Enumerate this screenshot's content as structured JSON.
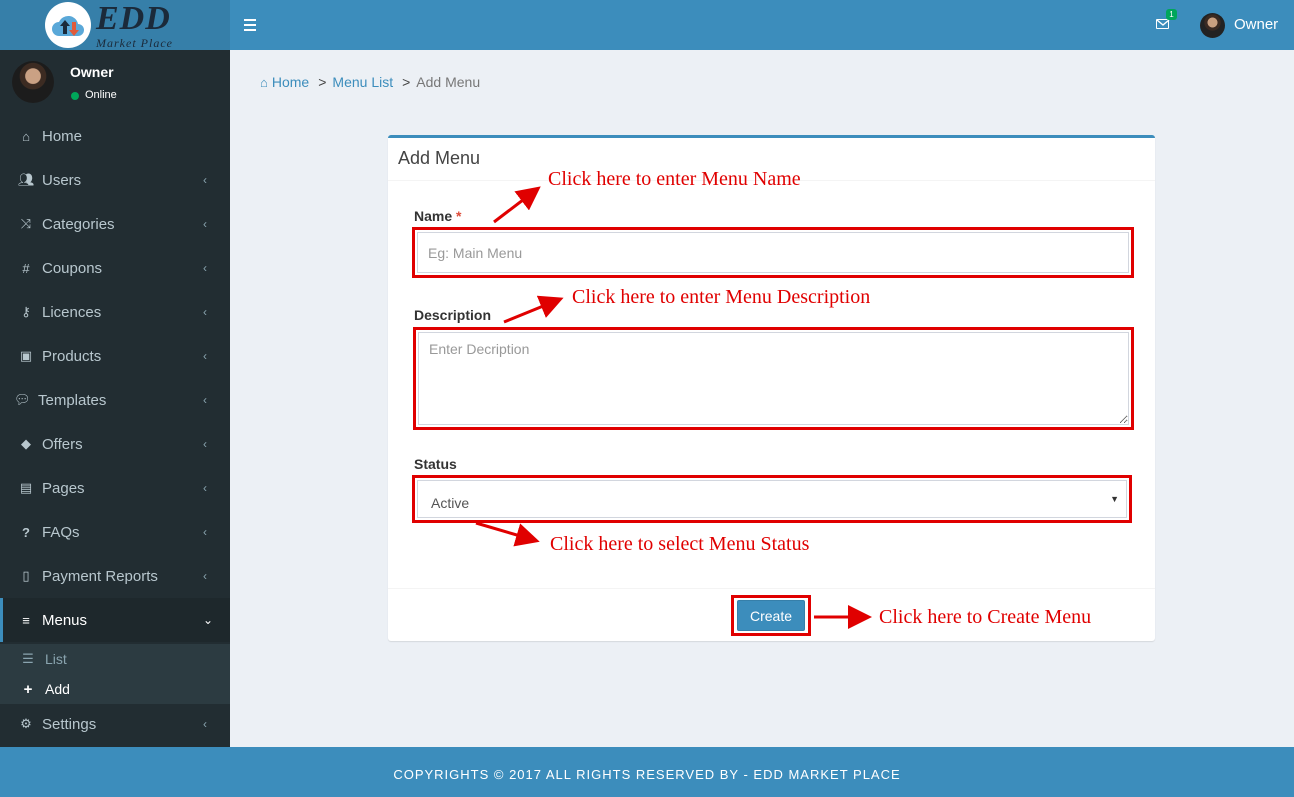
{
  "brand": {
    "title": "EDD",
    "subtitle": "Market Place"
  },
  "topbar": {
    "mail_badge": "1",
    "user_name": "Owner"
  },
  "sidebar": {
    "user": {
      "name": "Owner",
      "status": "Online"
    },
    "items": [
      {
        "label": "Home",
        "icon": "home-icon"
      },
      {
        "label": "Users",
        "icon": "users-icon"
      },
      {
        "label": "Categories",
        "icon": "shuffle-icon"
      },
      {
        "label": "Coupons",
        "icon": "hashtag-icon"
      },
      {
        "label": "Licences",
        "icon": "key-icon"
      },
      {
        "label": "Products",
        "icon": "shopping-bag-icon"
      },
      {
        "label": "Templates",
        "icon": "comments-icon"
      },
      {
        "label": "Offers",
        "icon": "tags-icon"
      },
      {
        "label": "Pages",
        "icon": "file-text-icon"
      },
      {
        "label": "FAQs",
        "icon": "question-icon"
      },
      {
        "label": "Payment Reports",
        "icon": "file-icon"
      },
      {
        "label": "Menus",
        "icon": "bars-icon"
      },
      {
        "label": "Settings",
        "icon": "cog-icon"
      }
    ],
    "submenu": [
      {
        "label": "List",
        "icon": "list-icon"
      },
      {
        "label": "Add",
        "icon": "plus-icon"
      }
    ]
  },
  "breadcrumb": {
    "home": "Home",
    "list": "Menu List",
    "current": "Add Menu",
    "sep": ">"
  },
  "form": {
    "title": "Add Menu",
    "name_label": "Name",
    "required_mark": "*",
    "name_placeholder": "Eg: Main Menu",
    "name_value": "",
    "description_label": "Description",
    "description_placeholder": "Enter Decription",
    "description_value": "",
    "status_label": "Status",
    "status_value": "Active",
    "create_label": "Create"
  },
  "annotations": {
    "name": "Click here to enter Menu Name",
    "description": "Click here to enter Menu Description",
    "status": "Click here to select Menu Status",
    "create": "Click here to Create Menu"
  },
  "colors": {
    "primary": "#3c8dbc",
    "primary_dark": "#367fa9",
    "sidebar": "#222d32",
    "annotation": "#e00000"
  },
  "footer": {
    "text": "COPYRIGHTS © 2017 ALL RIGHTS RESERVED BY - EDD MARKET PLACE"
  }
}
